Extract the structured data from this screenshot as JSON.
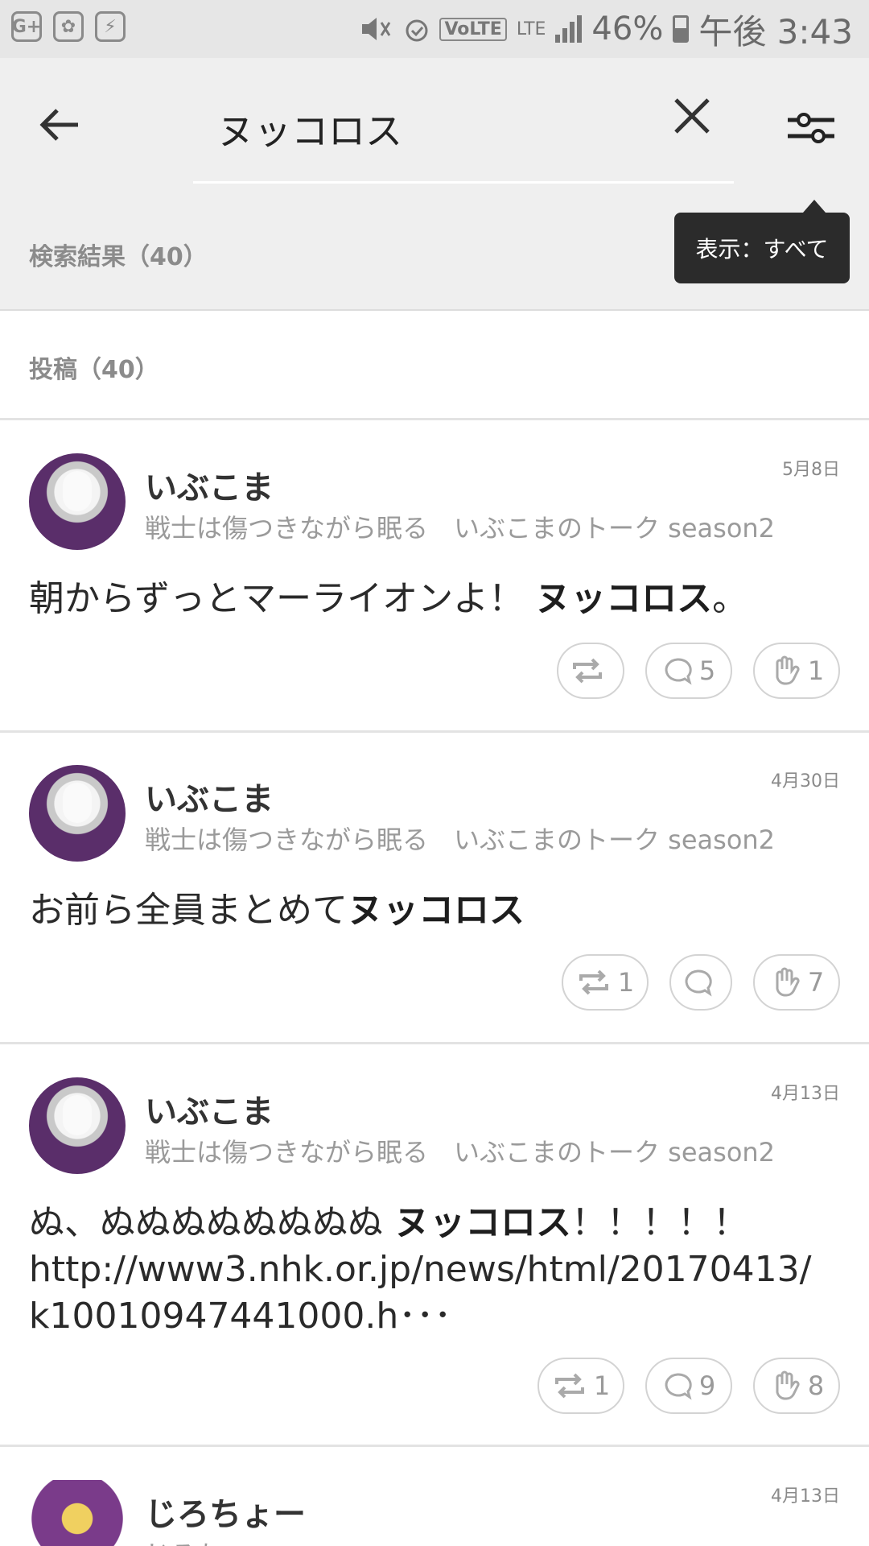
{
  "status_bar": {
    "left_icons": [
      "G+",
      "✿",
      "⚡"
    ],
    "lte_label": "LTE",
    "volte_label": "VoLTE",
    "battery_percent": "46%",
    "time": "午後 3:43"
  },
  "header": {
    "search_value": "ヌッコロス",
    "results_label": "検索結果（40）",
    "tooltip": "表示：すべて"
  },
  "section": {
    "title": "投稿（40）"
  },
  "posts": [
    {
      "name": "いぶこま",
      "meta": "戦士は傷つきながら眠る　いぶこまのトーク season2",
      "date": "5月8日",
      "text_before": "朝からずっとマーライオンよ！ ",
      "text_bold": "ヌッコロス",
      "text_after": "。",
      "repost_count": "",
      "comment_count": "5",
      "like_count": "1"
    },
    {
      "name": "いぶこま",
      "meta": "戦士は傷つきながら眠る　いぶこまのトーク season2",
      "date": "4月30日",
      "text_before": "お前ら全員まとめて",
      "text_bold": "ヌッコロス",
      "text_after": "",
      "repost_count": "1",
      "comment_count": "",
      "like_count": "7"
    },
    {
      "name": "いぶこま",
      "meta": "戦士は傷つきながら眠る　いぶこまのトーク season2",
      "date": "4月13日",
      "text_before": "ぬ、ぬぬぬぬぬぬぬぬ ",
      "text_bold": "ヌッコロス",
      "text_after": "！！！！！",
      "line2": "http://www3.nhk.or.jp/news/html/20170413/",
      "line3": "k10010947441000.h･･･",
      "repost_count": "1",
      "comment_count": "9",
      "like_count": "8"
    },
    {
      "name": "じろちょー",
      "meta": "じろちょー",
      "date": "4月13日"
    }
  ]
}
